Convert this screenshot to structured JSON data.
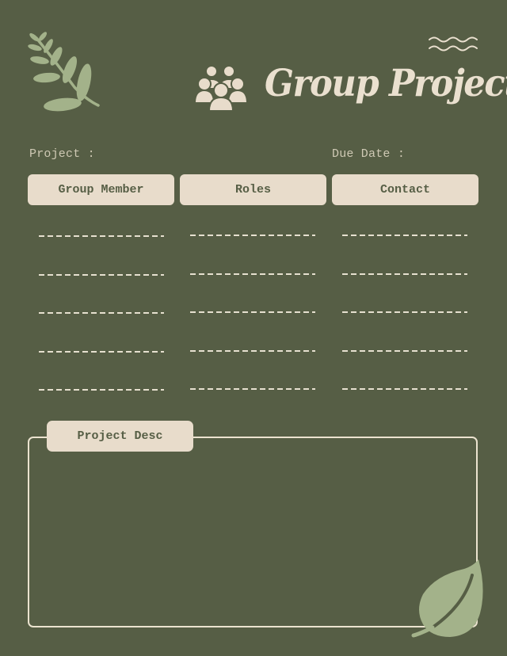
{
  "header": {
    "title": "Group Project",
    "icons": [
      "branch-icon",
      "people-group-icon",
      "waves-icon"
    ]
  },
  "fields": {
    "project_label": "Project :",
    "due_date_label": "Due Date :"
  },
  "table": {
    "columns": [
      "Group Member",
      "Roles",
      "Contact"
    ],
    "row_count": 5
  },
  "description": {
    "label": "Project Desc"
  },
  "colors": {
    "background": "#565e45",
    "cream": "#e8dccb",
    "leaf_green": "#a3b28a"
  }
}
